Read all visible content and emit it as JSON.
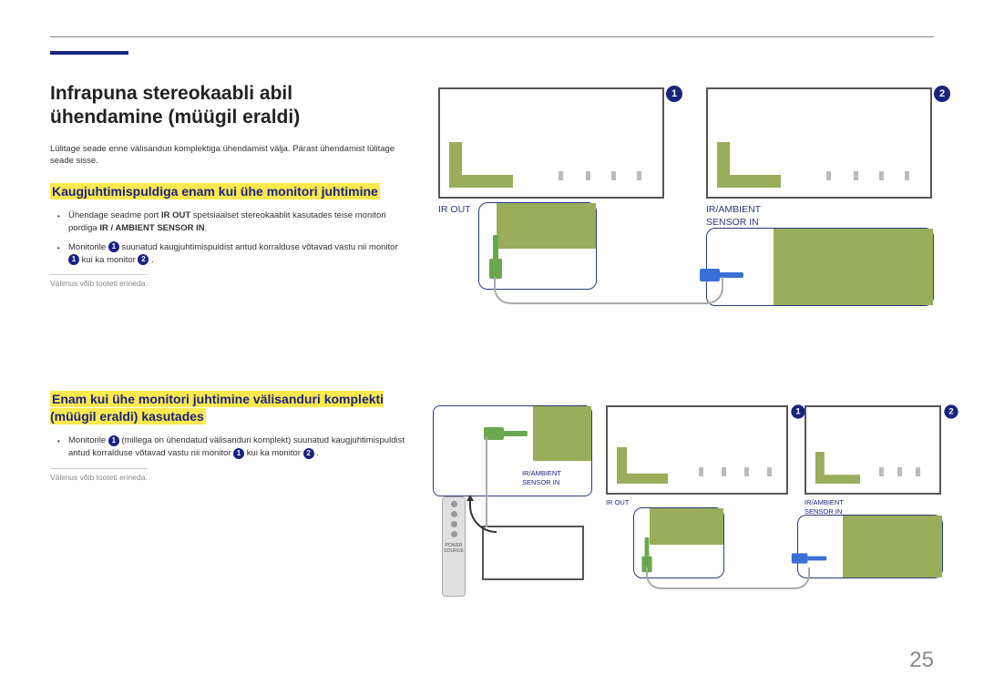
{
  "page_number": "25",
  "title": "Infrapuna stereokaabli abil ühendamine (müügil eraldi)",
  "intro": "Lülitage seade enne välisanduri komplektiga ühendamist välja. Pärast ühendamist lülitage seade sisse.",
  "section1": {
    "heading": "Kaugjuhtimispuldiga enam kui ühe monitori juhtimine",
    "bullet1_pre": "Ühendage seadme port ",
    "bullet1_bold1": "IR OUT",
    "bullet1_mid": " spetsiaalset stereokaablit kasutades teise monitori pordiga ",
    "bullet1_bold2": "IR / AMBIENT SENSOR IN",
    "bullet1_post": ".",
    "bullet2_pre": "Monitorile ",
    "bullet2_mid1": " suunatud kaugjuhtimispuldist antud korralduse võtavad vastu nii monitor ",
    "bullet2_mid2": " kui ka monitor ",
    "bullet2_post": " .",
    "footnote": "Välimus võib tooteti erineda."
  },
  "section2": {
    "heading": "Enam kui ühe monitori juhtimine välisanduri komplekti (müügil eraldi) kasutades",
    "bullet1_pre": "Monitorile ",
    "bullet1_mid1": " (millega on ühendatud välisanduri komplekt) suunatud kaugjuhtimispuldist antud korralduse võtavad vastu nii monitor ",
    "bullet1_mid2": " kui ka monitor ",
    "bullet1_post": " .",
    "footnote": "Välimus võib tooteti erineda."
  },
  "labels": {
    "ir_out": "IR OUT",
    "ir_ambient_sensor_in": "IR/AMBIENT SENSOR IN",
    "ir_ambient_sensor_in_2line_a": "IR/AMBIENT",
    "ir_ambient_sensor_in_2line_b": "SENSOR IN",
    "power": "POWER",
    "source": "SOURCE"
  },
  "nums": {
    "one": "1",
    "two": "2"
  }
}
